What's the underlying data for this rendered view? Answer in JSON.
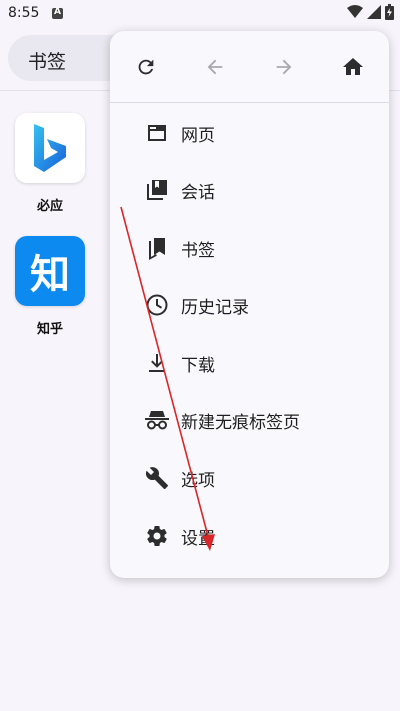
{
  "status_bar": {
    "time": "8:55"
  },
  "url_bar": {
    "text": "书签"
  },
  "shortcuts": [
    {
      "label": "必应"
    },
    {
      "label": "知乎",
      "icon_text": "知"
    }
  ],
  "menu": {
    "toolbar": [
      "refresh-icon",
      "back-arrow-icon",
      "forward-arrow-icon",
      "home-icon"
    ],
    "items": [
      {
        "label": "网页",
        "icon": "tab-icon"
      },
      {
        "label": "会话",
        "icon": "collections-icon"
      },
      {
        "label": "书签",
        "icon": "bookmark-icon"
      },
      {
        "label": "历史记录",
        "icon": "history-icon"
      },
      {
        "label": "下载",
        "icon": "download-icon"
      },
      {
        "label": "新建无痕标签页",
        "icon": "incognito-icon"
      },
      {
        "label": "选项",
        "icon": "wrench-icon"
      },
      {
        "label": "设置",
        "icon": "gear-icon"
      }
    ]
  },
  "colors": {
    "accent_arrow": "#d9262a",
    "zhihu_blue": "#0d8af0"
  }
}
